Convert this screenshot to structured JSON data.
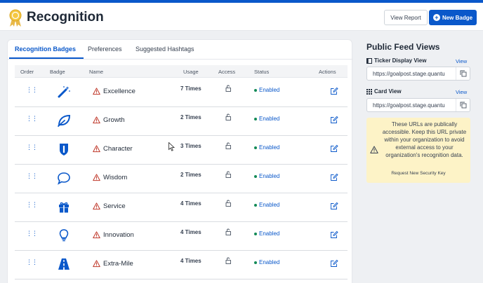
{
  "header": {
    "title": "Recognition",
    "view_report_label": "View Report",
    "new_badge_label": "New Badge",
    "accent_color": "#0a58ca"
  },
  "tabs": [
    {
      "label": "Recognition Badges",
      "active": true
    },
    {
      "label": "Preferences",
      "active": false
    },
    {
      "label": "Suggested Hashtags",
      "active": false
    }
  ],
  "table": {
    "columns": [
      "Order",
      "Badge",
      "Name",
      "Usage",
      "Access",
      "Status",
      "Actions"
    ],
    "rows": [
      {
        "name": "Excellence",
        "usage": "7 Times",
        "status": "Enabled",
        "icon": "magic-wand-icon"
      },
      {
        "name": "Growth",
        "usage": "2 Times",
        "status": "Enabled",
        "icon": "leaf-icon"
      },
      {
        "name": "Character",
        "usage": "3 Times",
        "status": "Enabled",
        "icon": "shield-icon"
      },
      {
        "name": "Wisdom",
        "usage": "2 Times",
        "status": "Enabled",
        "icon": "speech-bubble-icon"
      },
      {
        "name": "Service",
        "usage": "4 Times",
        "status": "Enabled",
        "icon": "gift-icon"
      },
      {
        "name": "Innovation",
        "usage": "4 Times",
        "status": "Enabled",
        "icon": "lightbulb-icon"
      },
      {
        "name": "Extra-Mile",
        "usage": "4 Times",
        "status": "Enabled",
        "icon": "road-icon"
      }
    ]
  },
  "public_feed": {
    "title": "Public Feed Views",
    "ticker": {
      "label": "Ticker Display View",
      "view_label": "View",
      "url": "https://goalpost.stage.quantu"
    },
    "card": {
      "label": "Card View",
      "view_label": "View",
      "url": "https://goalpost.stage.quantu"
    },
    "notice": {
      "text": "These URLs are publically accessible. Keep this URL private within your organization to avoid external access to your organization's recognition data.",
      "link": "Request New Security Key"
    }
  }
}
